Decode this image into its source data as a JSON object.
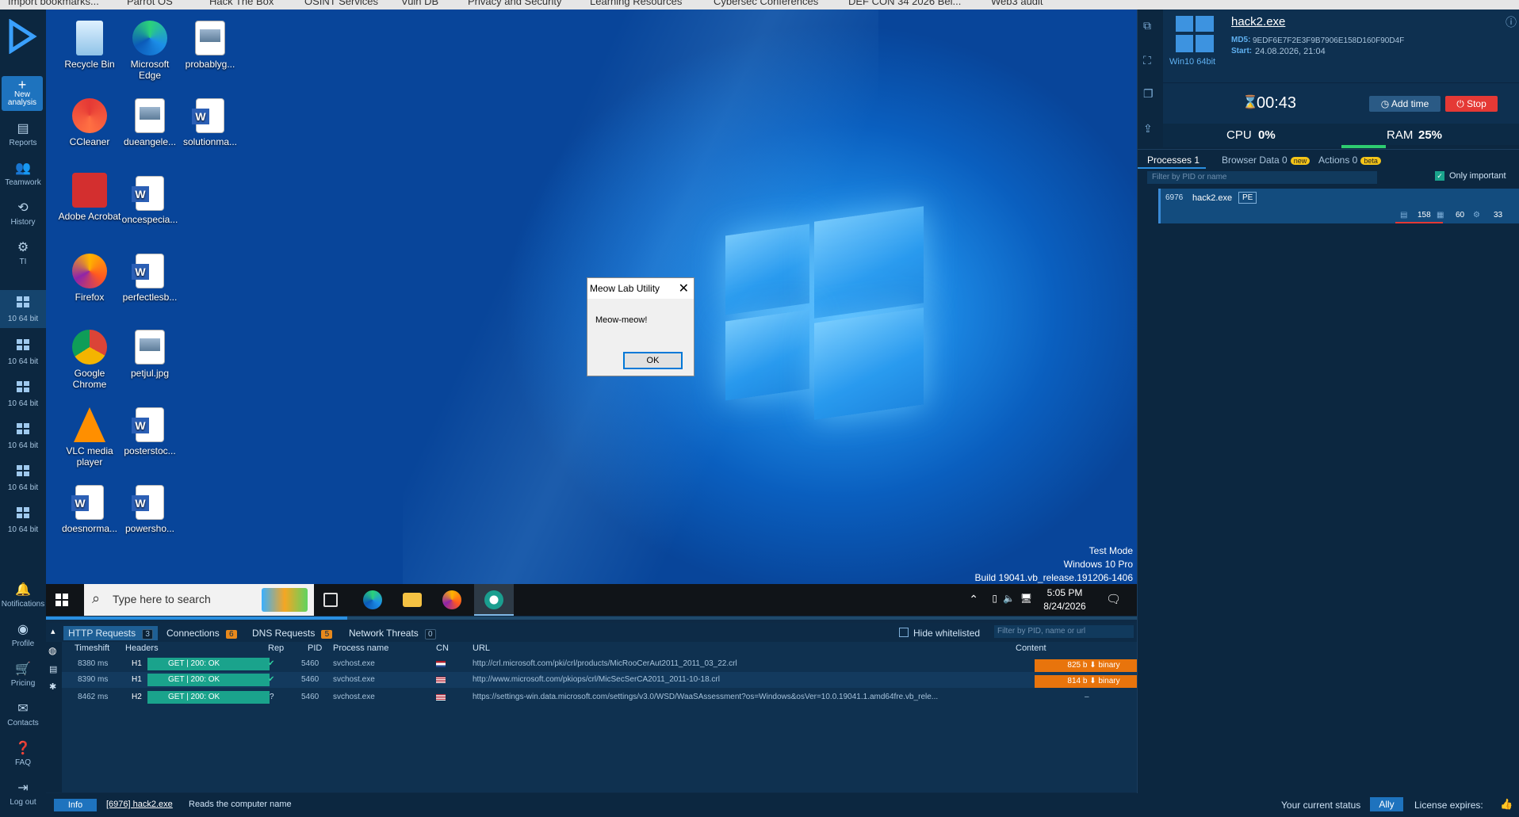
{
  "bookmarks": [
    "Import bookmarks...",
    "Parrot OS",
    "Hack The Box",
    "OSINT Services",
    "Vuln DB",
    "Privacy and Security",
    "Learning Resources",
    "Cybersec Conferences",
    "DEF CON 34 2026 Bel...",
    "Web3 audit"
  ],
  "nav": {
    "new_analysis": "New analysis",
    "reports": "Reports",
    "teamwork": "Teamwork",
    "history": "History",
    "ti": "TI",
    "vm_label": "10 64 bit",
    "notifications": "Notifications",
    "profile": "Profile",
    "pricing": "Pricing",
    "contacts": "Contacts",
    "faq": "FAQ",
    "logout": "Log out"
  },
  "desktop": {
    "icons": [
      {
        "label": "Recycle Bin",
        "icon": "recycle-bin-icon"
      },
      {
        "label": "Microsoft Edge",
        "icon": "edge-icon"
      },
      {
        "label": "probablyg...",
        "icon": "image-file-icon"
      },
      {
        "label": "CCleaner",
        "icon": "ccleaner-icon"
      },
      {
        "label": "dueangele...",
        "icon": "image-file-icon"
      },
      {
        "label": "solutionma...",
        "icon": "word-doc-icon"
      },
      {
        "label": "Adobe Acrobat",
        "icon": "acrobat-icon"
      },
      {
        "label": "oncespecia...",
        "icon": "word-doc-icon"
      },
      {
        "label": "Firefox",
        "icon": "firefox-icon"
      },
      {
        "label": "perfectlesb...",
        "icon": "word-doc-icon"
      },
      {
        "label": "Google Chrome",
        "icon": "chrome-icon"
      },
      {
        "label": "petjul.jpg",
        "icon": "image-file-icon"
      },
      {
        "label": "VLC media player",
        "icon": "vlc-icon"
      },
      {
        "label": "posterstoc...",
        "icon": "word-doc-icon"
      },
      {
        "label": "doesnorma...",
        "icon": "word-doc-icon"
      },
      {
        "label": "powersho...",
        "icon": "word-doc-icon"
      }
    ],
    "dialog": {
      "title": "Meow Lab Utility",
      "message": "Meow-meow!",
      "ok": "OK"
    },
    "watermark": [
      "Test Mode",
      "Windows 10 Pro",
      "Build 19041.vb_release.191206-1406"
    ]
  },
  "taskbar": {
    "search_placeholder": "Type here to search",
    "time": "5:05 PM",
    "date": "8/24/2026"
  },
  "network": {
    "tabs": [
      {
        "label": "HTTP Requests",
        "count": "3"
      },
      {
        "label": "Connections",
        "count": "6"
      },
      {
        "label": "DNS Requests",
        "count": "5"
      },
      {
        "label": "Network Threats",
        "count": "0"
      }
    ],
    "hide_whitelisted": "Hide whitelisted",
    "filter_placeholder": "Filter by PID, name or url",
    "columns": {
      "timeshift": "Timeshift",
      "headers": "Headers",
      "rep": "Rep",
      "pid": "PID",
      "process": "Process name",
      "cn": "CN",
      "url": "URL",
      "content": "Content"
    },
    "rows": [
      {
        "timeshift": "8380 ms",
        "proto": "H1",
        "status": "GET  |  200: OK",
        "rep": "✔",
        "pid": "5460",
        "process": "svchost.exe",
        "cn": "nl",
        "url": "http://crl.microsoft.com/pki/crl/products/MicRooCerAut2011_2011_03_22.crl",
        "content": "825 b  ⬇  binary"
      },
      {
        "timeshift": "8390 ms",
        "proto": "H1",
        "status": "GET  |  200: OK",
        "rep": "✔",
        "pid": "5460",
        "process": "svchost.exe",
        "cn": "us",
        "url": "http://www.microsoft.com/pkiops/crl/MicSecSerCA2011_2011-10-18.crl",
        "content": "814 b  ⬇  binary"
      },
      {
        "timeshift": "8462 ms",
        "proto": "H2",
        "status": "GET  |  200: OK",
        "rep": "?",
        "pid": "5460",
        "process": "svchost.exe",
        "cn": "us",
        "url": "https://settings-win.data.microsoft.com/settings/v3.0/WSD/WaaSAssessment?os=Windows&osVer=10.0.19041.1.amd64fre.vb_rele...",
        "content": "–"
      }
    ]
  },
  "footer": {
    "info": "Info",
    "process": "[6976] hack2.exe",
    "message": "Reads the computer name",
    "status_label": "Your current status",
    "status_value": "Ally",
    "license": "License expires:"
  },
  "task": {
    "filename": "hack2.exe",
    "os": "Win10 64bit",
    "md5_label": "MD5:",
    "md5": "9EDF6E7F2E3F9B7906E158D160F90D4F",
    "start_label": "Start:",
    "start": "24.08.2026, 21:04",
    "timer": "00:43",
    "add_time": "Add time",
    "stop": "Stop",
    "cpu_label": "CPU",
    "cpu": "0%",
    "ram_label": "RAM",
    "ram": "25%",
    "ram_fraction": 0.25
  },
  "processes": {
    "tabs": [
      {
        "label": "Processes 1"
      },
      {
        "label": "Browser Data  0",
        "badge": "new"
      },
      {
        "label": "Actions  0",
        "badge": "beta"
      }
    ],
    "filter_placeholder": "Filter by PID or name",
    "only_important": "Only important",
    "items": [
      {
        "pid": "6976",
        "name": "hack2.exe",
        "tag": "PE",
        "files": "158",
        "reg": "60",
        "mods": "33"
      }
    ]
  },
  "colors": {
    "accent": "#1e73be",
    "stop": "#e53935",
    "content_orange": "#e8740c",
    "status_green": "#1aa38c"
  }
}
